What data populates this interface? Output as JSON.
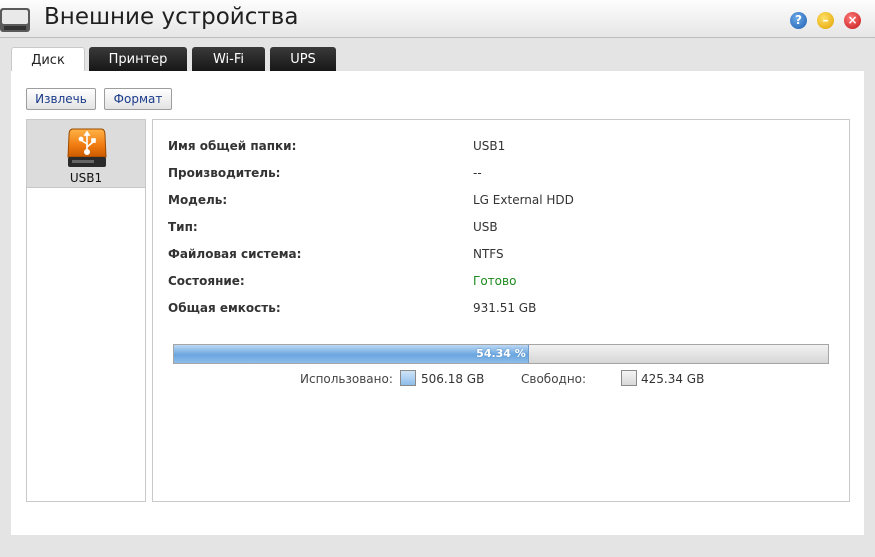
{
  "window": {
    "title": "Внешние устройства"
  },
  "tabs": [
    {
      "label": "Диск",
      "active": true
    },
    {
      "label": "Принтер",
      "active": false
    },
    {
      "label": "Wi-Fi",
      "active": false
    },
    {
      "label": "UPS",
      "active": false
    }
  ],
  "toolbar": {
    "eject_label": "Извлечь",
    "format_label": "Формат"
  },
  "devices": [
    {
      "label": "USB1",
      "icon": "usb-drive-icon",
      "selected": true
    }
  ],
  "details": [
    {
      "key": "Имя общей папки:",
      "value": "USB1"
    },
    {
      "key": "Производитель:",
      "value": "--"
    },
    {
      "key": "Модель:",
      "value": "LG External HDD"
    },
    {
      "key": "Тип:",
      "value": "USB"
    },
    {
      "key": "Файловая система:",
      "value": "NTFS"
    },
    {
      "key": "Состояние:",
      "value": "Готово"
    },
    {
      "key": "Общая емкость:",
      "value": "931.51 GB"
    }
  ],
  "usage": {
    "percent_label": "54.34 %",
    "used_fraction": 0.5434,
    "used_label": "Использовано:",
    "used_value": "506.18 GB",
    "free_label": "Свободно:",
    "free_value": "425.34 GB"
  },
  "colors": {
    "status_ok": "#1b8a1b",
    "used_fill": "#6aa6e0",
    "free_fill": "#d8d8d8",
    "usb_orange": "#f07a10"
  }
}
